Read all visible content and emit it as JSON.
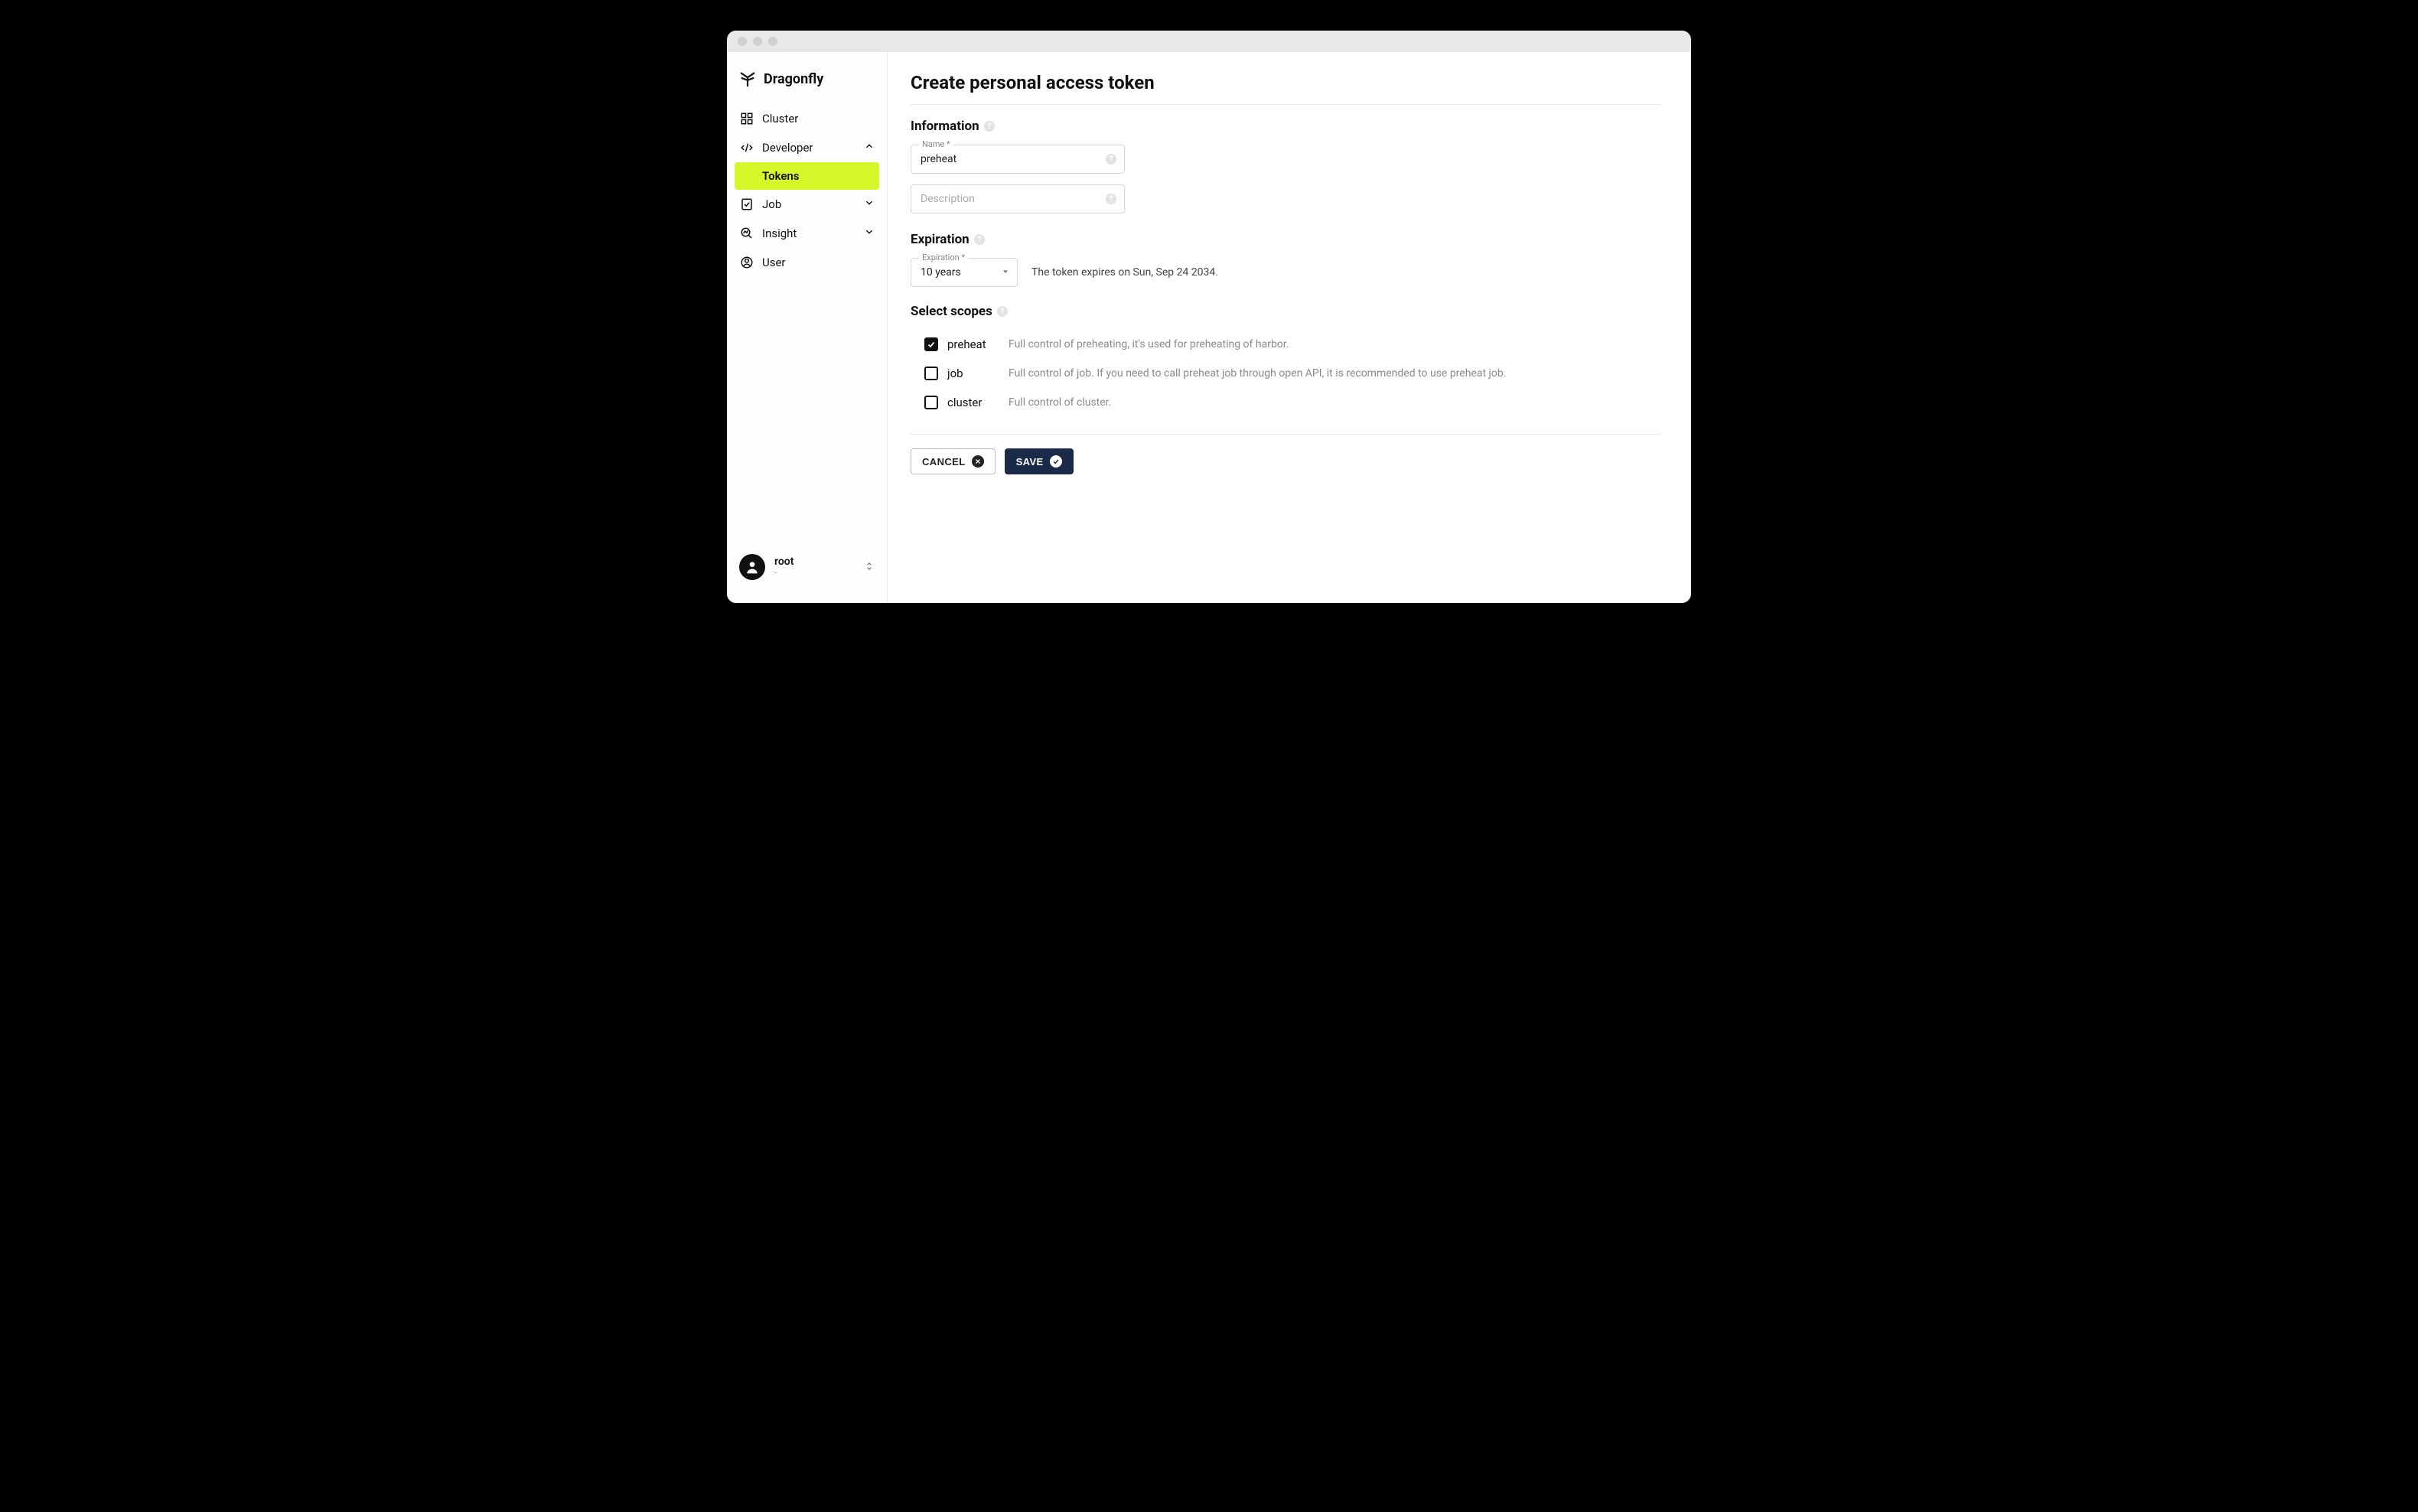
{
  "brand": {
    "name": "Dragonfly"
  },
  "sidebar": {
    "items": [
      {
        "label": "Cluster"
      },
      {
        "label": "Developer",
        "expanded": true,
        "sub": [
          {
            "label": "Tokens",
            "active": true
          }
        ]
      },
      {
        "label": "Job"
      },
      {
        "label": "Insight"
      },
      {
        "label": "User"
      }
    ],
    "user": {
      "name": "root",
      "sub": "-"
    }
  },
  "page": {
    "title": "Create personal access token"
  },
  "information": {
    "heading": "Information",
    "name_label": "Name *",
    "name_value": "preheat",
    "description_placeholder": "Description"
  },
  "expiration": {
    "heading": "Expiration",
    "label": "Expiration *",
    "value": "10 years",
    "note": "The token expires on Sun, Sep 24 2034."
  },
  "scopes": {
    "heading": "Select scopes",
    "items": [
      {
        "name": "preheat",
        "checked": true,
        "desc": "Full control of preheating, it's used for preheating of harbor."
      },
      {
        "name": "job",
        "checked": false,
        "desc": "Full control of job. If you need to call preheat job through open API, it is recommended to use preheat job."
      },
      {
        "name": "cluster",
        "checked": false,
        "desc": "Full control of cluster."
      }
    ]
  },
  "buttons": {
    "cancel": "Cancel",
    "save": "Save"
  }
}
